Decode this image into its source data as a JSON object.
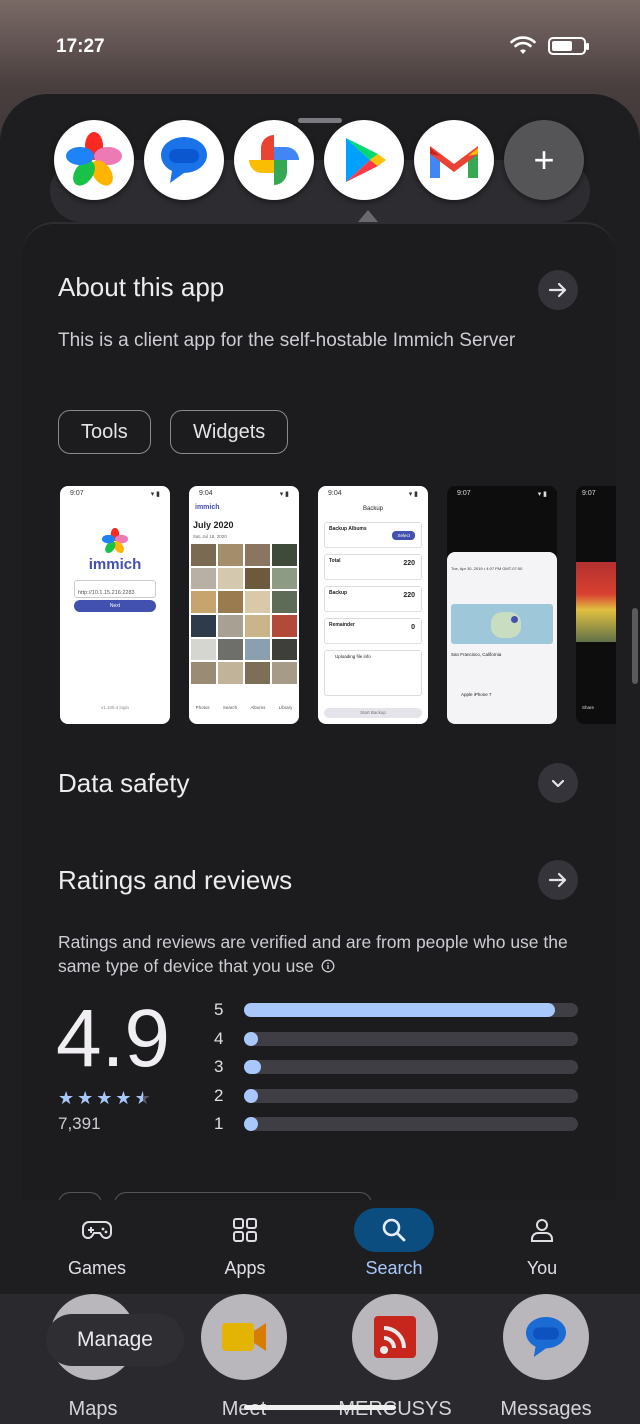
{
  "status": {
    "time": "17:27"
  },
  "about": {
    "title": "About this app",
    "description": "This is a client app for the self-hostable Immich Server",
    "chips": [
      "Tools",
      "Widgets"
    ]
  },
  "screenshots": [
    {
      "time": "9:07",
      "brand": "immich",
      "url": "http://10.1.15.216:2283",
      "button": "Next",
      "footer": "v1.105.4 login"
    },
    {
      "time": "9:04",
      "brand": "immich",
      "heading": "July 2020",
      "date": "Sat, Jul 18, 2020",
      "nav": [
        "Photos",
        "Search",
        "Albums",
        "Library"
      ]
    },
    {
      "time": "9:04",
      "title": "Backup",
      "rows": [
        {
          "label": "Backup Albums",
          "value": "Select"
        },
        {
          "label": "Total",
          "value": "220"
        },
        {
          "label": "Backup",
          "value": "220"
        },
        {
          "label": "Remainder",
          "value": "0"
        }
      ],
      "status": "Uploading file info",
      "button": "Start Backup"
    },
    {
      "time": "9:07",
      "date": "Tue, Apr 30, 2019 • 4:07 PM GMT-07:00",
      "location": "San Francisco, California",
      "camera": "Apple iPhone 7"
    },
    {
      "time": "9:07",
      "label": "Share"
    }
  ],
  "data_safety": {
    "title": "Data safety"
  },
  "ratings": {
    "title": "Ratings and reviews",
    "description": "Ratings and reviews are verified and are from people who use the same type of device that you use",
    "score": "4.9",
    "star_level": 4.5,
    "count": "7,391",
    "bars": [
      {
        "label": "5",
        "fraction": 0.93
      },
      {
        "label": "4",
        "fraction": 0.04
      },
      {
        "label": "3",
        "fraction": 0.05
      },
      {
        "label": "2",
        "fraction": 0.04
      },
      {
        "label": "1",
        "fraction": 0.04
      }
    ]
  },
  "nav": {
    "games": "Games",
    "apps": "Apps",
    "search": "Search",
    "you": "You",
    "active": "search"
  },
  "dock": {
    "manage": "Manage",
    "apps": [
      "Maps",
      "Meet",
      "MERCUSYS",
      "Messages"
    ]
  },
  "colors": {
    "accent": "#a8c7fa",
    "active_pill": "#0b4d7e"
  }
}
